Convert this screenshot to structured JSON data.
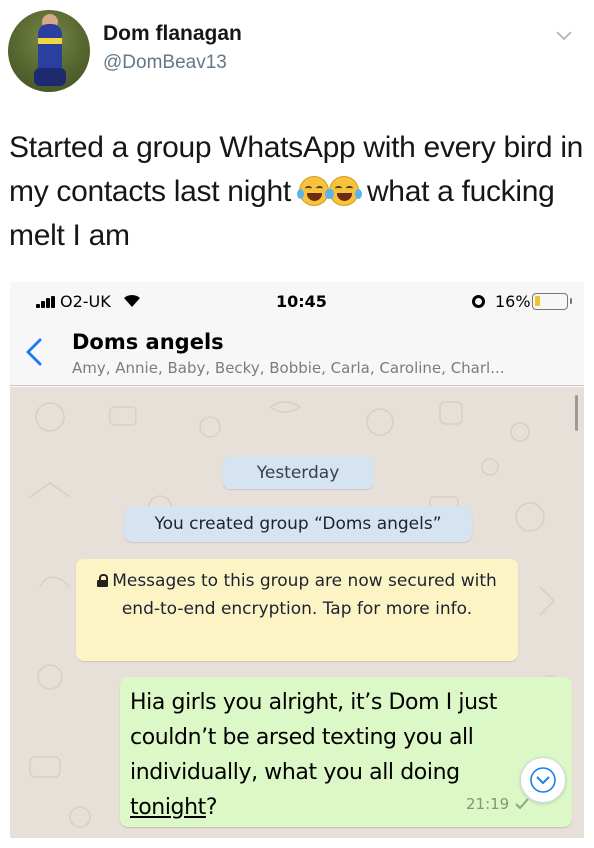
{
  "tweet": {
    "name": "Dom flanagan",
    "handle": "@DomBeav13",
    "text_before_emoji": "Started a group WhatsApp with every bird in my contacts last night ",
    "emoji_name": "face-with-tears-of-joy-icon",
    "emoji_count": 2,
    "text_after_emoji": " what a fucking melt I am"
  },
  "statusbar": {
    "carrier": "O2-UK",
    "time": "10:45",
    "battery_percent": "16%",
    "battery_level": 0.16
  },
  "chat": {
    "title": "Doms angels",
    "members": "Amy, Annie, Baby, Becky, Bobbie, Carla, Caroline, Charl..."
  },
  "messages": {
    "date_label": "Yesterday",
    "system_notice": "You created group “Doms angels”",
    "encryption_notice": "Messages to this group are now secured with end-to-end encryption. Tap for more info.",
    "sent": {
      "text": "Hia girls you alright, it’s Dom I just couldn’t be arsed texting you all individually, what you all doing ",
      "link_text": "tonight",
      "text_end": "?",
      "time": "21:19"
    }
  },
  "colors": {
    "sent_bubble": "#dcf8c6",
    "system_bubble": "#d6e3f3",
    "encryption_bubble": "#fdf4c5",
    "chat_background": "#e6e0d8"
  }
}
